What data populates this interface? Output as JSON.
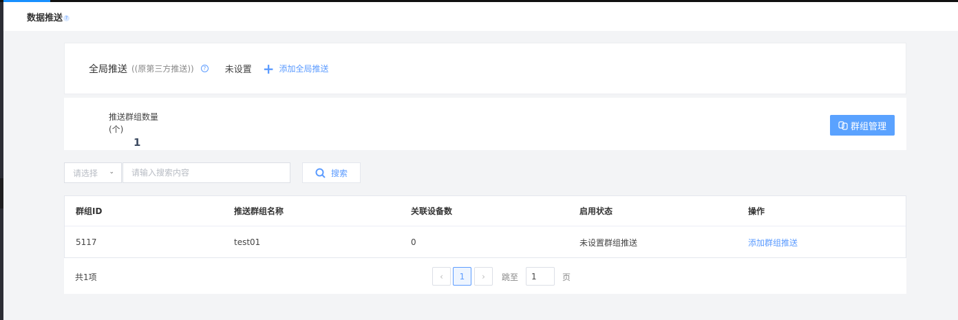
{
  "header": {
    "title": "数据推送",
    "help_icon": "question-icon"
  },
  "global_push": {
    "label": "全局推送",
    "sub_label": "((原第三方推送))",
    "status": "未设置",
    "add_label": "添加全局推送"
  },
  "group_stats": {
    "label_line1": "推送群组数量",
    "label_line2": "(个)",
    "count": "1",
    "manage_button": "群组管理"
  },
  "filter": {
    "select_placeholder": "请选择",
    "search_placeholder": "请输入搜索内容",
    "search_button": "搜索"
  },
  "table": {
    "columns": [
      "群组ID",
      "推送群组名称",
      "关联设备数",
      "启用状态",
      "操作"
    ],
    "rows": [
      {
        "id": "5117",
        "name": "test01",
        "devices": "0",
        "status": "未设置群组推送",
        "action": "添加群组推送"
      }
    ]
  },
  "pagination": {
    "total": "共1项",
    "current": "1",
    "jump_label": "跳至",
    "jump_value": "1",
    "page_suffix": "页"
  },
  "colors": {
    "accent": "#5b9bff",
    "button": "#5aa2ff",
    "background": "#f3f4f6"
  }
}
